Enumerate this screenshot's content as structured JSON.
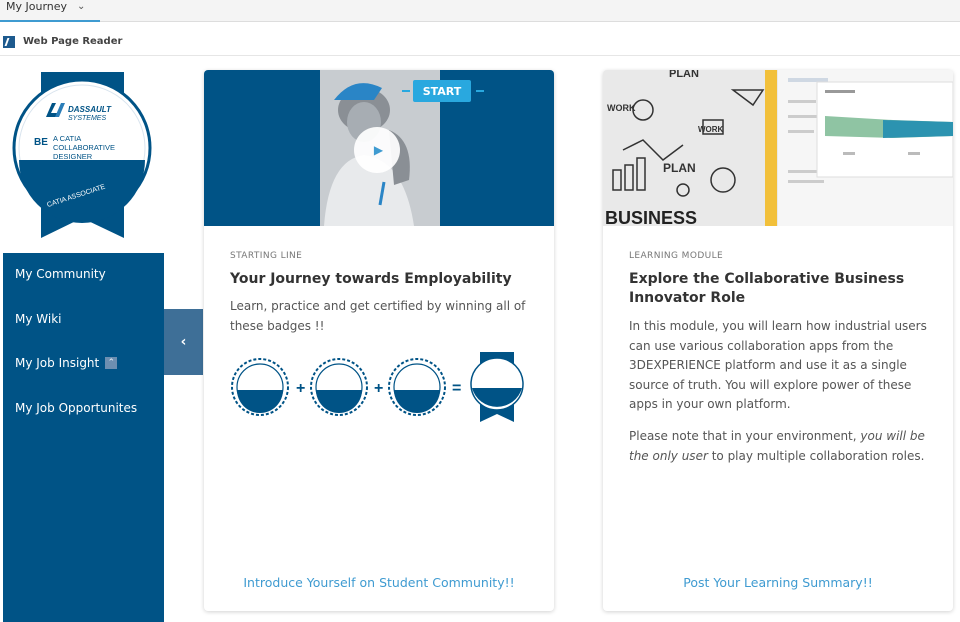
{
  "tabs": {
    "active_label": "My Journey"
  },
  "reader": {
    "label": "Web Page Reader"
  },
  "badge": {
    "brand_line1": "DASSAULT",
    "brand_line2": "SYSTEMES",
    "be": "BE",
    "role_line1": "A CATIA",
    "role_line2": "COLLABORATIVE",
    "role_line3": "DESIGNER",
    "ribbon_text": "CATIA ASSOCIATE"
  },
  "sidebar": {
    "items": [
      {
        "label": "My Community"
      },
      {
        "label": "My Wiki"
      },
      {
        "label": "My Job Insight"
      },
      {
        "label": "My Job Opportunites"
      }
    ]
  },
  "cards": [
    {
      "start_label": "START",
      "kicker": "STARTING LINE",
      "title": "Your Journey towards Employability",
      "body": "Learn, practice and get certified by winning all of these badges !!",
      "operators": [
        "+",
        "+",
        "="
      ],
      "link": "Introduce Yourself on Student Community!!"
    },
    {
      "hero_words": {
        "plan": "PLAN",
        "work": "WORK",
        "business": "BUSINESS"
      },
      "kicker": "LEARNING MODULE",
      "title": "Explore the Collaborative Business Innovator Role",
      "body_p1": "In this module, you will learn how industrial users can use various collaboration apps from the 3DEXPERIENCE platform and use it as a single source of truth. You will explore power of these apps in your own platform.",
      "body_p2_a": "Please note that in your environment, ",
      "body_p2_em": "you will be the only user",
      "body_p2_b": " to play multiple collaboration roles.",
      "link": "Post Your Learning Summary!!"
    }
  ],
  "colors": {
    "brand_blue": "#005386",
    "accent_blue": "#3f9bd1",
    "collapse_blue": "#3e6f97"
  }
}
